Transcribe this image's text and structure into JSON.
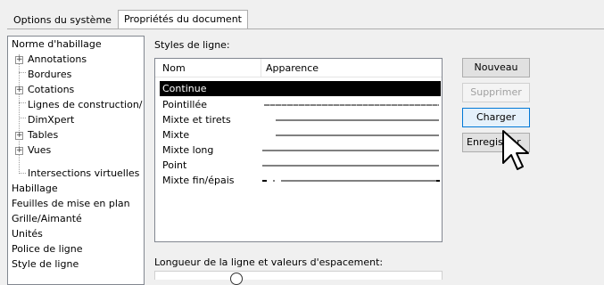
{
  "tabs": [
    {
      "label": "Options du système",
      "active": false
    },
    {
      "label": "Propriétés du document",
      "active": true
    }
  ],
  "tree": [
    {
      "label": "Norme d'habillage",
      "level": 0,
      "expandable": false
    },
    {
      "label": "Annotations",
      "level": 1,
      "expandable": true,
      "expander": "+"
    },
    {
      "label": "Bordures",
      "level": 1,
      "expandable": false
    },
    {
      "label": "Cotations",
      "level": 1,
      "expandable": true,
      "expander": "+"
    },
    {
      "label": "Lignes de construction/",
      "level": 1,
      "expandable": false
    },
    {
      "label": "DimXpert",
      "level": 1,
      "expandable": false
    },
    {
      "label": "Tables",
      "level": 1,
      "expandable": true,
      "expander": "+"
    },
    {
      "label": "Vues",
      "level": 1,
      "expandable": true,
      "expander": "+"
    },
    {
      "label": "Intersections virtuelles",
      "level": 1,
      "expandable": false
    },
    {
      "label": "Habillage",
      "level": 0,
      "expandable": false
    },
    {
      "label": "Feuilles de mise en plan",
      "level": 0,
      "expandable": false
    },
    {
      "label": "Grille/Aimanté",
      "level": 0,
      "expandable": false
    },
    {
      "label": "Unités",
      "level": 0,
      "expandable": false
    },
    {
      "label": "Police de ligne",
      "level": 0,
      "expandable": false
    },
    {
      "label": "Style de ligne",
      "level": 0,
      "expandable": false
    }
  ],
  "styles": {
    "label": "Styles de ligne:",
    "columns": [
      "Nom",
      "Apparence"
    ],
    "rows": [
      {
        "name": "Continue",
        "pattern": "continuous",
        "selected": true
      },
      {
        "name": "Pointillée",
        "pattern": "dotted",
        "selected": false
      },
      {
        "name": "Mixte et tirets",
        "pattern": "dash-dot",
        "selected": false
      },
      {
        "name": "Mixte",
        "pattern": "center",
        "selected": false
      },
      {
        "name": "Mixte long",
        "pattern": "long-dash",
        "selected": false
      },
      {
        "name": "Point",
        "pattern": "point",
        "selected": false
      },
      {
        "name": "Mixte fin/épais",
        "pattern": "chain-thick",
        "selected": false
      }
    ]
  },
  "buttons": {
    "new": "Nouveau",
    "delete": "Supprimer",
    "load": "Charger",
    "save": "Enregistrer"
  },
  "spacing": {
    "label": "Longueur de la ligne et valeurs d'espacement:"
  },
  "colors": {
    "selection": "#000000",
    "accent": "#0078d7"
  }
}
